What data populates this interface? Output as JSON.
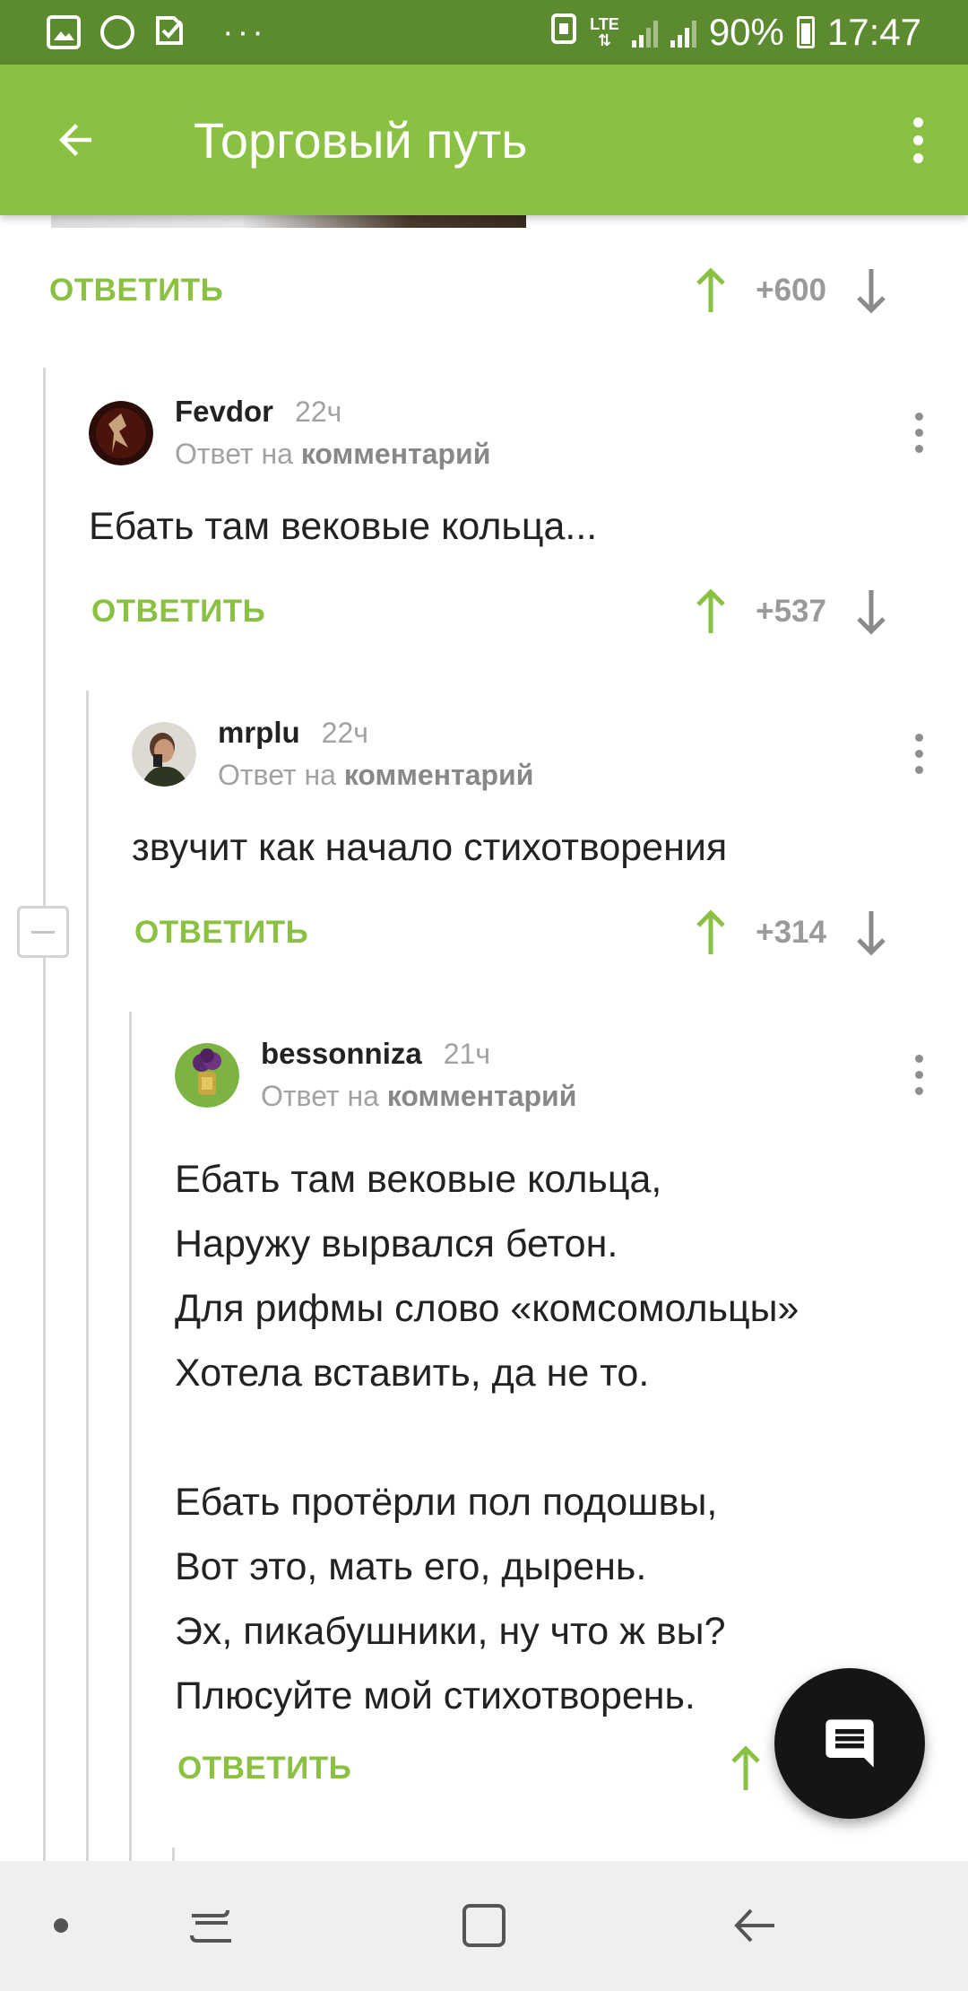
{
  "status_bar": {
    "battery": "90%",
    "time": "17:47",
    "network": "LTE",
    "icons": [
      "gallery-icon",
      "missed-call-icon",
      "check-icon",
      "more-icon",
      "nfc-icon",
      "lte-icon",
      "signal-icon",
      "roaming-signal-icon",
      "battery-icon"
    ]
  },
  "app_bar": {
    "title": "Торговый путь",
    "back_icon": "arrow-back-icon",
    "menu_icon": "more-vert-icon"
  },
  "colors": {
    "accent": "#8ac142",
    "status_bar": "#5c8a2f",
    "fab": "#151515"
  },
  "top_post_actions": {
    "reply_label": "ОТВЕТИТЬ",
    "score": "+600"
  },
  "comments": [
    {
      "author": "Fevdor",
      "time": "22ч",
      "reply_prefix": "Ответ на",
      "reply_target": "комментарий",
      "text": "Ебать там вековые кольца...",
      "reply_label": "ОТВЕТИТЬ",
      "score": "+537"
    },
    {
      "author": "mrplu",
      "time": "22ч",
      "reply_prefix": "Ответ на",
      "reply_target": "комментарий",
      "text": "звучит как начало стихотворения",
      "reply_label": "ОТВЕТИТЬ",
      "score": "+314"
    },
    {
      "author": "bessonniza",
      "time": "21ч",
      "reply_prefix": "Ответ на",
      "reply_target": "комментарий",
      "lines": [
        "Ебать там вековые кольца,",
        "Наружу вырвался бетон.",
        "Для рифмы слово «комсомольцы»",
        "Хотела вставить, да не то.",
        "",
        "Ебать протёрли пол подошвы,",
        "Вот это, мать его, дырень.",
        "Эх, пикабушники, ну что ж вы?",
        "Плюсуйте мой стихотворень."
      ],
      "reply_label": "ОТВЕТИТЬ"
    }
  ],
  "fab": {
    "icon": "comment-icon"
  },
  "nav_bar": {
    "items": [
      "dot-icon",
      "recent-apps-icon",
      "home-icon",
      "back-nav-icon"
    ]
  }
}
